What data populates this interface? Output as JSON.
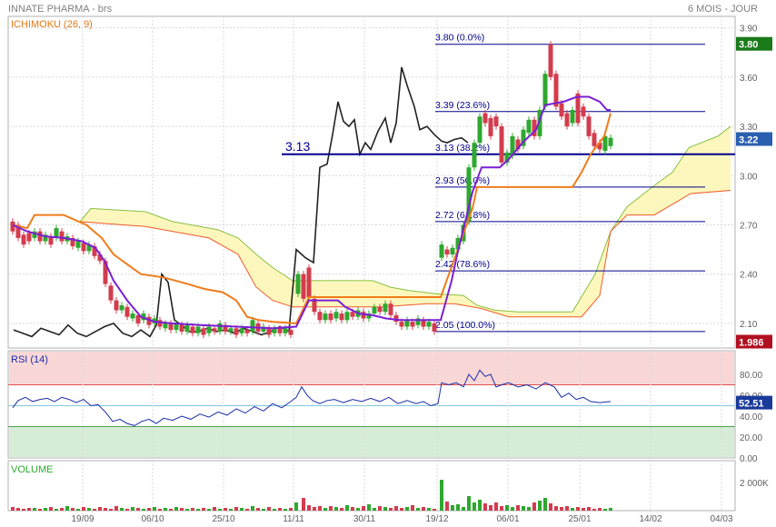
{
  "header": {
    "instrument": "INNATE PHARMA - brs",
    "period": "6 MOIS - JOUR"
  },
  "colors": {
    "up": "#2ea82e",
    "down": "#d33c4e",
    "price_line": "#222222",
    "tenkan": "#7a1fd6",
    "kijun": "#f07c1a",
    "cloud_fill": "#fdf7bd",
    "span_a": "#88c040",
    "span_b": "#f05a2a",
    "fib": "#00008b",
    "rsi": "#1a2ea8",
    "rsi_overbought": "#f9d7d7",
    "rsi_oversold": "#d7ecd7"
  },
  "chart_data": [
    {
      "type": "candlestick",
      "indicator_label": "ICHIMOKU (26, 9)",
      "ylim": [
        1.95,
        3.97
      ],
      "y_ticks": [
        "3.90",
        "3.60",
        "3.30",
        "3.00",
        "2.70",
        "2.40",
        "2.10"
      ],
      "x_ticks": [
        "19/09",
        "06/10",
        "25/10",
        "11/11",
        "30/11",
        "19/12",
        "06/01",
        "25/01",
        "14/02",
        "04/03"
      ],
      "price_badges": {
        "high": {
          "label": "3.80",
          "color": "#1a7a1a"
        },
        "last": {
          "label": "3.22",
          "color": "#2a5fb0"
        },
        "low": {
          "label": "1.986",
          "color": "#b01020"
        }
      },
      "fibonacci": [
        {
          "label": "3.80  (0.0%)",
          "value": 3.8
        },
        {
          "label": "3.39  (23.6%)",
          "value": 3.39
        },
        {
          "label": "3.13  (38.2%)",
          "value": 3.13
        },
        {
          "label": "2.93  (50.0%)",
          "value": 2.93
        },
        {
          "label": "2.72  (61.8%)",
          "value": 2.72
        },
        {
          "label": "2.42  (78.6%)",
          "value": 2.42
        },
        {
          "label": "2.05  (100.0%)",
          "value": 2.05
        }
      ],
      "support_line": {
        "label": "3.13",
        "value": 3.13
      }
    },
    {
      "type": "line",
      "indicator_label": "RSI (14)",
      "ylim": [
        0,
        100
      ],
      "y_ticks": [
        "80.00",
        "60.00",
        "40.00",
        "20.00",
        "0.00"
      ],
      "zones": {
        "overbought": 70,
        "oversold": 30
      },
      "last_value": "52.51"
    },
    {
      "type": "bar",
      "indicator_label": "VOLUME",
      "y_ticks": [
        "2 000K"
      ]
    }
  ]
}
